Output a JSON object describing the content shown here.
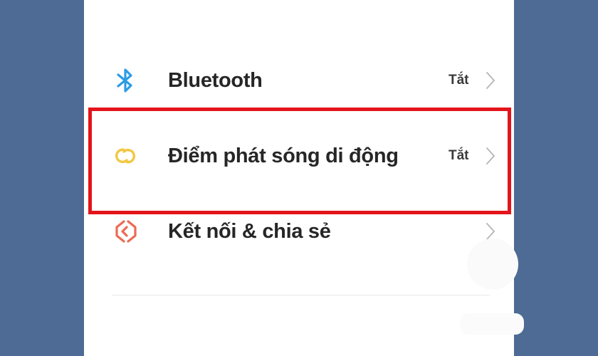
{
  "settings": {
    "items": [
      {
        "label": "Bluetooth",
        "status": "Tắt",
        "icon": "bluetooth-icon",
        "icon_color": "#2d9be6"
      },
      {
        "label": "Điểm phát sóng di động",
        "status": "Tắt",
        "icon": "hotspot-icon",
        "icon_color": "#f2c744"
      },
      {
        "label": "Kết nối & chia sẻ",
        "status": "",
        "icon": "connection-sharing-icon",
        "icon_color": "#ec6a55"
      }
    ]
  },
  "colors": {
    "background": "#4d6b94",
    "panel": "#ffffff",
    "highlight_border": "#e4141b",
    "chevron": "#b9b9b9"
  }
}
